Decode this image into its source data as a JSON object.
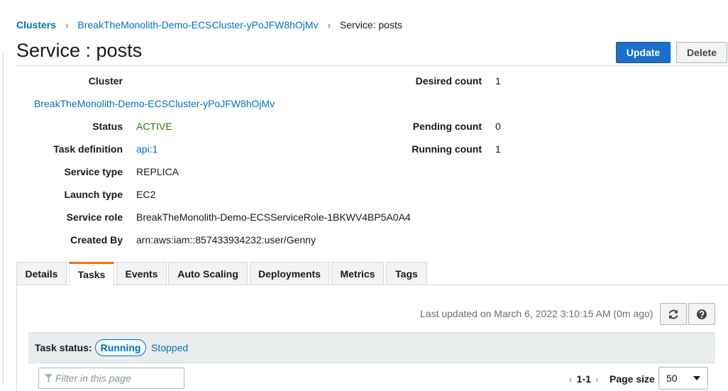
{
  "breadcrumb": {
    "root": "Clusters",
    "cluster": "BreakTheMonolith-Demo-ECSCluster-yPoJFW8hOjMv",
    "current": "Service: posts"
  },
  "page": {
    "title": "Service : posts"
  },
  "actions": {
    "update": "Update",
    "delete": "Delete"
  },
  "details": {
    "cluster_label": "Cluster",
    "cluster_value": "BreakTheMonolith-Demo-ECSCluster-yPoJFW8hOjMv",
    "status_label": "Status",
    "status_value": "ACTIVE",
    "taskdef_label": "Task definition",
    "taskdef_value": "api:1",
    "servicetype_label": "Service type",
    "servicetype_value": "REPLICA",
    "launchtype_label": "Launch type",
    "launchtype_value": "EC2",
    "servicerole_label": "Service role",
    "servicerole_value": "BreakTheMonolith-Demo-ECSServiceRole-1BKWV4BP5A0A4",
    "createdby_label": "Created By",
    "createdby_value": "arn:aws:iam::857433934232:user/Genny",
    "desired_label": "Desired count",
    "desired_value": "1",
    "pending_label": "Pending count",
    "pending_value": "0",
    "running_label": "Running count",
    "running_value": "1"
  },
  "tabs": [
    "Details",
    "Tasks",
    "Events",
    "Auto Scaling",
    "Deployments",
    "Metrics",
    "Tags"
  ],
  "active_tab": "Tasks",
  "tasks": {
    "last_updated": "Last updated on March 6, 2022 3:10:15 AM (0m ago)",
    "status_label": "Task status:",
    "running": "Running",
    "stopped": "Stopped",
    "filter_placeholder": "Filter in this page",
    "pagination": "1-1",
    "page_size_label": "Page size",
    "page_size": "50"
  },
  "icons": {
    "refresh": "refresh-icon",
    "help": "help-icon",
    "filter": "filter-icon",
    "chevron": "chevron-down-icon"
  },
  "colors": {
    "link": "#0073bb",
    "primary_button": "#1a70c9",
    "active_status": "#1d8102",
    "active_tab_accent": "#ec7211"
  }
}
